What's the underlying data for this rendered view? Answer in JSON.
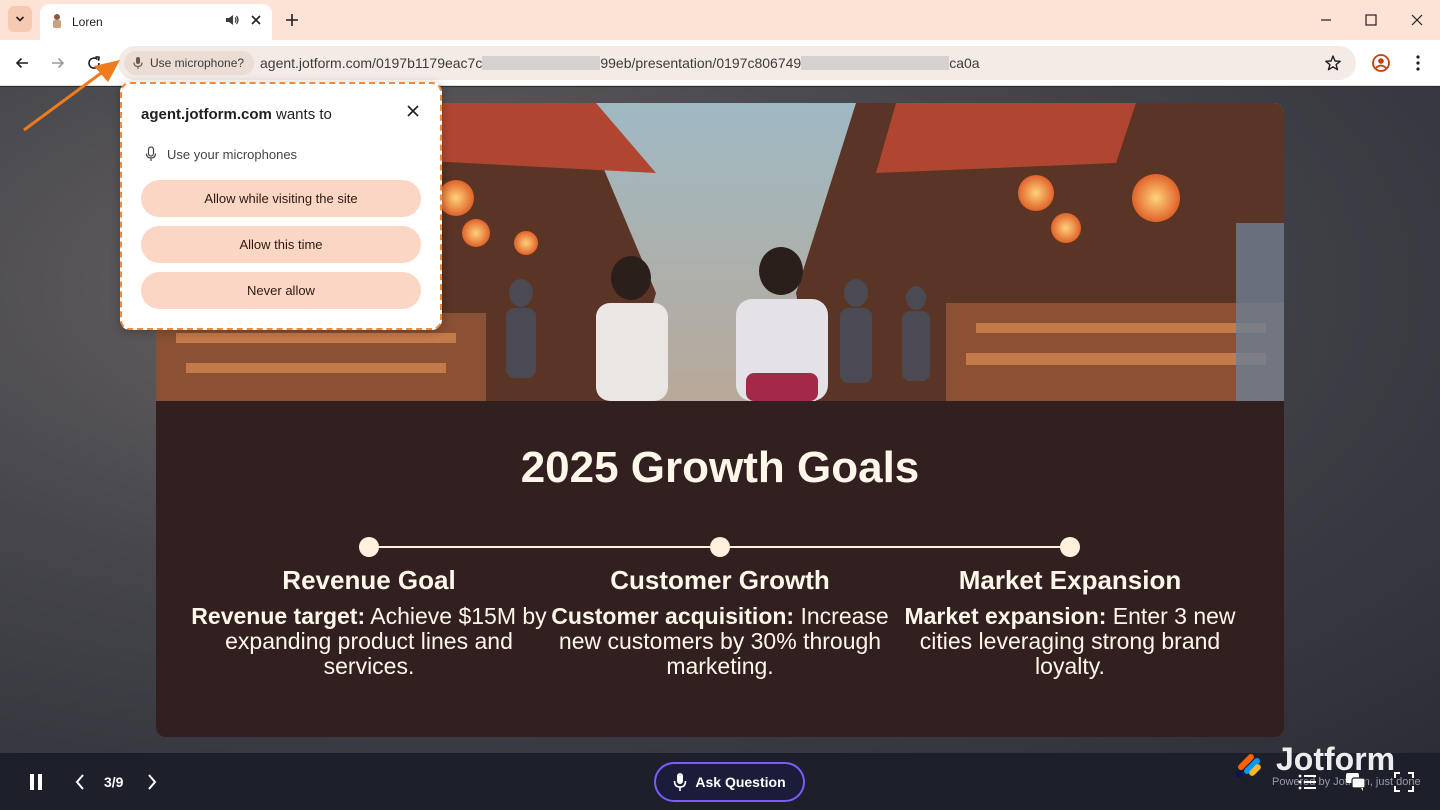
{
  "browser": {
    "tab": {
      "title": "Loren"
    },
    "omnibox": {
      "mic_chip": "Use microphone?",
      "url_start": "agent.jotform.com/0197b1179eac7c",
      "url_mid": "99eb/presentation/0197c806749",
      "url_end": "ca0a"
    }
  },
  "permission": {
    "site": "agent.jotform.com",
    "wants_to": " wants to",
    "request": "Use your microphones",
    "buttons": [
      "Allow while visiting the site",
      "Allow this time",
      "Never allow"
    ]
  },
  "slide": {
    "title": "2025 Growth Goals",
    "goals": [
      {
        "title": "Revenue Goal",
        "lead": "Revenue target:",
        "text": " Achieve $15M by expanding product lines and services."
      },
      {
        "title": "Customer Growth",
        "lead": "Customer acquisition:",
        "text": " Increase new customers by 30% through marketing."
      },
      {
        "title": "Market Expansion",
        "lead": "Market expansion:",
        "text": " Enter 3 new cities leveraging strong brand loyalty."
      }
    ]
  },
  "controls": {
    "page_counter": "3/9",
    "ask_button": "Ask Question",
    "brand": "Jotform",
    "powered_by": "Powered by Jotform, just done"
  },
  "colors": {
    "accent_orange": "#f08a3c",
    "chip_bg": "#fcd6c4",
    "slide_bg": "#321f20",
    "ask_border": "#7c5cff"
  }
}
